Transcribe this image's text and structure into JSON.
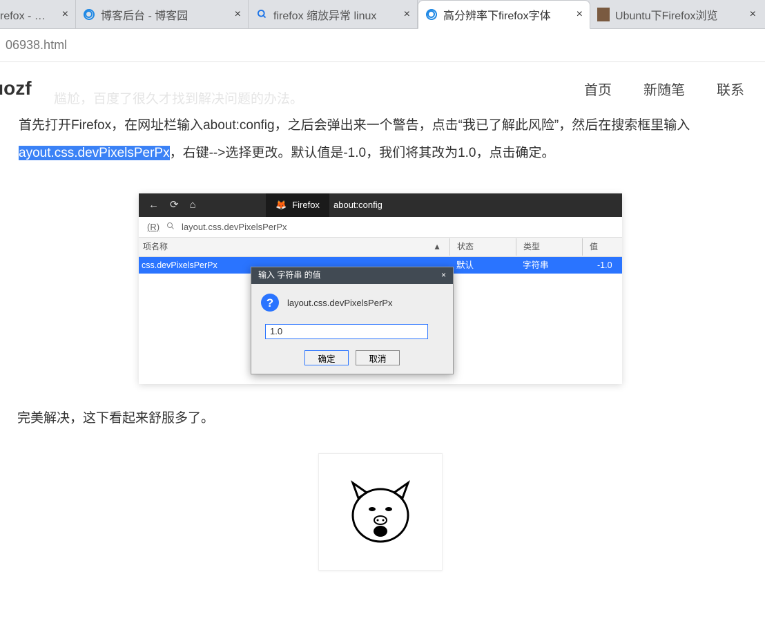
{
  "tabs": [
    {
      "title": "refox - 博客",
      "icon": "none"
    },
    {
      "title": "博客后台 - 博客园",
      "icon": "cnblogs"
    },
    {
      "title": "firefox 缩放异常 linux",
      "icon": "search"
    },
    {
      "title": "高分辨率下firefox字体",
      "icon": "cnblogs"
    },
    {
      "title": "Ubuntu下Firefox浏览",
      "icon": "avatar"
    }
  ],
  "close_glyph": "×",
  "url": "06938.html",
  "site": {
    "logo": "uozf",
    "nav": {
      "a": "首页",
      "b": "新随笔",
      "c": "联系"
    }
  },
  "ghost": "尴尬，百度了很久才找到解决问题的办法。",
  "article": {
    "p1_a": "首先打开Firefox，在网址栏输入about:config，之后会弹出来一个警告，点击“我已了解此风险”，然后在搜索框里输入",
    "p1_hl": "ayout.css.devPixelsPerPx",
    "p1_b": "，右键-->选择更改。默认值是-1.0，我们将其改为1.0，点击确定。",
    "p2": "完美解决，这下看起来舒服多了。"
  },
  "ff": {
    "nav": {
      "back": "←",
      "reload": "⟳",
      "home": "⌂"
    },
    "tab_label": "Firefox",
    "address": "about:config",
    "search_prefix": "(R)",
    "search_icon": "🔍",
    "search_query": "layout.css.devPixelsPerPx",
    "columns": {
      "name": "项名称",
      "sort": "▲",
      "status": "状态",
      "type": "类型",
      "value": "值"
    },
    "row": {
      "name": "css.devPixelsPerPx",
      "status": "默认",
      "type": "字符串",
      "value": "-1.0"
    },
    "dialog": {
      "title": "输入 字符串 的值",
      "close": "×",
      "label": "layout.css.devPixelsPerPx",
      "input_value": "1.0",
      "ok": "确定",
      "cancel": "取消"
    }
  }
}
